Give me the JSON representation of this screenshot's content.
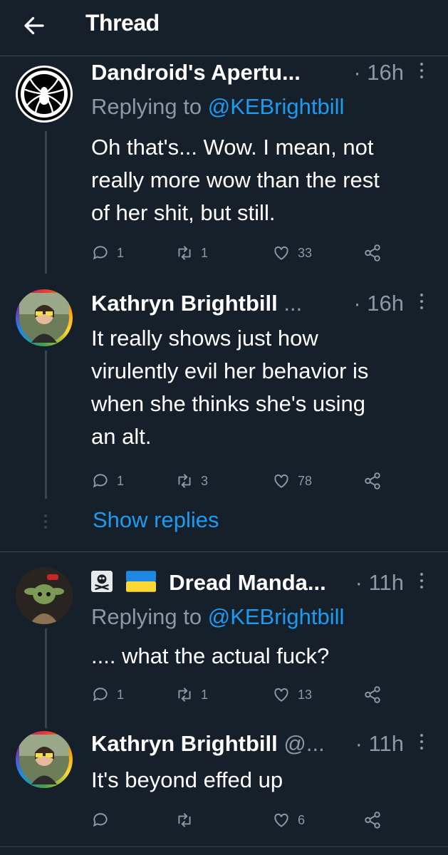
{
  "header": {
    "title": "Thread"
  },
  "tweets": [
    {
      "name": "Dandroid's Apertu...",
      "time": "· 16h",
      "replying_label": "Replying to",
      "replying_to": "@KEBrightbill",
      "lines": [
        "Oh that's... Wow. I mean, not",
        "really more wow than the rest",
        "of her shit, but still."
      ],
      "replies": "1",
      "retweets": "1",
      "likes": "33"
    },
    {
      "name": "Kathryn Brightbill",
      "name_suffix": "...",
      "time": "· 16h",
      "lines": [
        "It really shows just how",
        "virulently evil her behavior is",
        "when she thinks she's using",
        "an alt."
      ],
      "replies": "1",
      "retweets": "3",
      "likes": "78"
    },
    {
      "name": "Dread Manda...",
      "time": "· 11h",
      "replying_label": "Replying to",
      "replying_to": "@KEBrightbill",
      "lines": [
        ".... what the actual fuck?"
      ],
      "replies": "1",
      "retweets": "1",
      "likes": "13"
    },
    {
      "name": "Kathryn Brightbill",
      "name_suffix": "@...",
      "time": "· 11h",
      "lines": [
        "It's beyond effed up"
      ],
      "likes": "6"
    }
  ],
  "show_replies": "Show replies",
  "colors": {
    "background": "#15202b",
    "accent": "#1d9bf0",
    "muted": "#8b98a5",
    "divider": "#38444d"
  }
}
